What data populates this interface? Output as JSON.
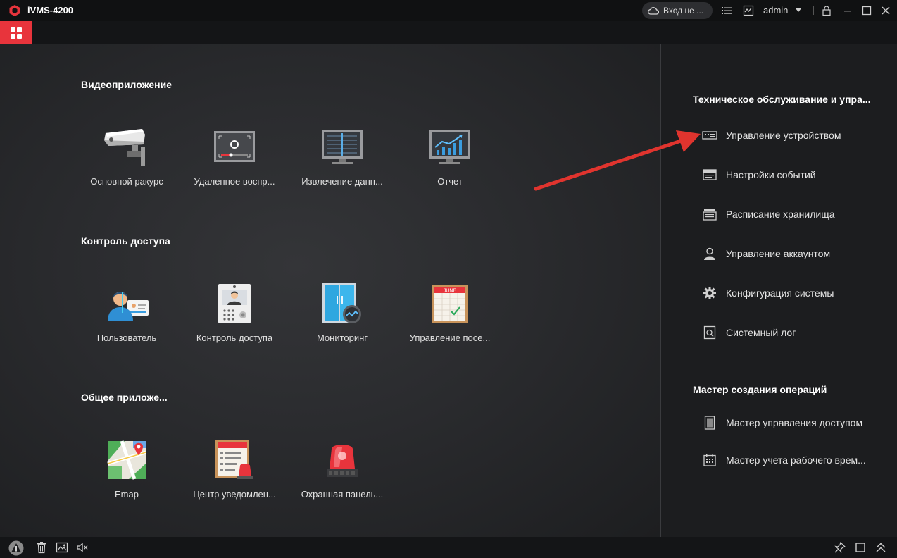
{
  "app": {
    "title": "iVMS-4200"
  },
  "titlebar": {
    "cloud_label": "Вход не ...",
    "user": "admin"
  },
  "sections": {
    "video": {
      "title": "Видеоприложение",
      "items": [
        {
          "label": "Основной ракурс",
          "icon": "camera-icon"
        },
        {
          "label": "Удаленное воспр...",
          "icon": "playback-icon"
        },
        {
          "label": "Извлечение данн...",
          "icon": "data-retrieval-icon"
        },
        {
          "label": "Отчет",
          "icon": "report-chart-icon"
        }
      ]
    },
    "access": {
      "title": "Контроль доступа",
      "items": [
        {
          "label": "Пользователь",
          "icon": "user-card-icon"
        },
        {
          "label": "Контроль доступа",
          "icon": "intercom-icon"
        },
        {
          "label": "Мониторинг",
          "icon": "door-monitor-icon"
        },
        {
          "label": "Управление посе...",
          "icon": "calendar-icon",
          "calendar_text": "JUNE"
        }
      ]
    },
    "general": {
      "title": "Общее приложе...",
      "items": [
        {
          "label": "Emap",
          "icon": "map-icon"
        },
        {
          "label": "Центр уведомлен...",
          "icon": "notification-center-icon"
        },
        {
          "label": "Охранная панель...",
          "icon": "alarm-siren-icon"
        }
      ]
    }
  },
  "right_panel": {
    "maintenance": {
      "title": "Техническое обслуживание и упра...",
      "items": [
        {
          "label": "Управление устройством",
          "icon": "device-icon"
        },
        {
          "label": "Настройки событий",
          "icon": "event-icon"
        },
        {
          "label": "Расписание хранилища",
          "icon": "storage-icon"
        },
        {
          "label": "Управление аккаунтом",
          "icon": "account-icon"
        },
        {
          "label": "Конфигурация системы",
          "icon": "gear-icon"
        },
        {
          "label": "Системный лог",
          "icon": "log-icon"
        }
      ]
    },
    "wizard": {
      "title": "Мастер создания операций",
      "items": [
        {
          "label": "Мастер управления доступом",
          "icon": "access-wizard-icon"
        },
        {
          "label": "Мастер учета рабочего врем...",
          "icon": "time-wizard-icon"
        }
      ]
    }
  },
  "colors": {
    "accent": "#e8343c",
    "arrow": "#e0342e",
    "bg": "#2a2b2e"
  }
}
